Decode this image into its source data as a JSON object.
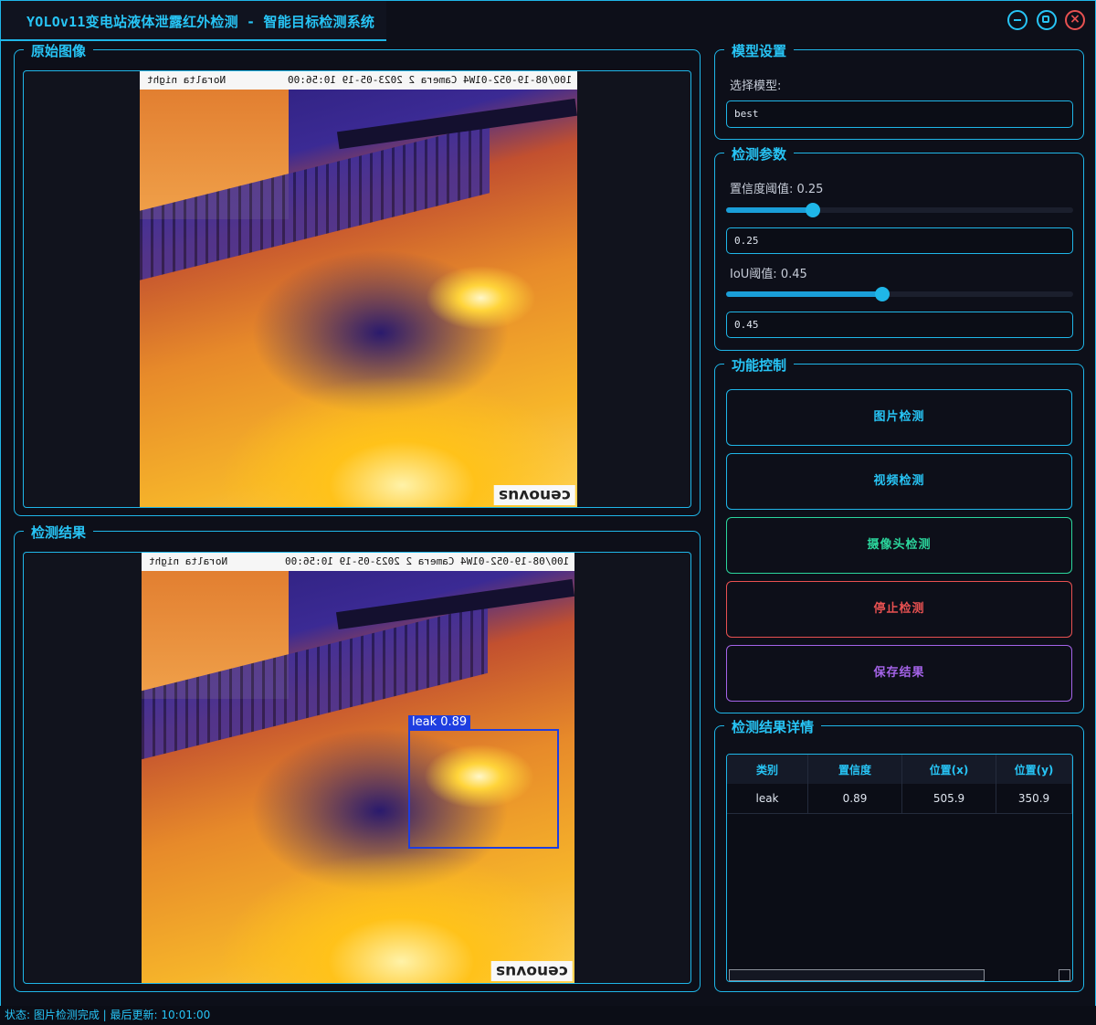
{
  "window": {
    "title": "YOLOv11变电站液体泄露红外检测 - 智能目标检测系统"
  },
  "colors": {
    "accent": "#1fb6e8",
    "stop": "#e85151",
    "camera": "#2bd59c",
    "save": "#a463e8",
    "bbox": "#1f3ee0"
  },
  "original": {
    "group_label": "原始图像",
    "overlay_left": "Noralta night",
    "overlay_right": "100/08-19-052-01W4 Camera 2 2023-05-19 10:56:00",
    "logo": "cenovus"
  },
  "result": {
    "group_label": "检测结果",
    "overlay_left": "Noralta night",
    "overlay_right": "100/08-19-052-01W4 Camera 2 2023-05-19 10:56:00",
    "logo": "cenovus",
    "box_label": "leak 0.89"
  },
  "model": {
    "group_label": "模型设置",
    "select_label": "选择模型:",
    "selected": "best"
  },
  "params": {
    "group_label": "检测参数",
    "conf_label": "置信度阈值: 0.25",
    "conf_value": "0.25",
    "conf": 0.25,
    "iou_label": "IoU阈值: 0.45",
    "iou_value": "0.45",
    "iou": 0.45
  },
  "controls": {
    "group_label": "功能控制",
    "image_btn": "图片检测",
    "video_btn": "视频检测",
    "camera_btn": "摄像头检测",
    "stop_btn": "停止检测",
    "save_btn": "保存结果"
  },
  "details": {
    "group_label": "检测结果详情",
    "headers": [
      "类别",
      "置信度",
      "位置(x)",
      "位置(y)"
    ],
    "rows": [
      [
        "leak",
        "0.89",
        "505.9",
        "350.9"
      ]
    ]
  },
  "status": {
    "text": "状态: 图片检测完成 | 最后更新: 10:01:00"
  }
}
